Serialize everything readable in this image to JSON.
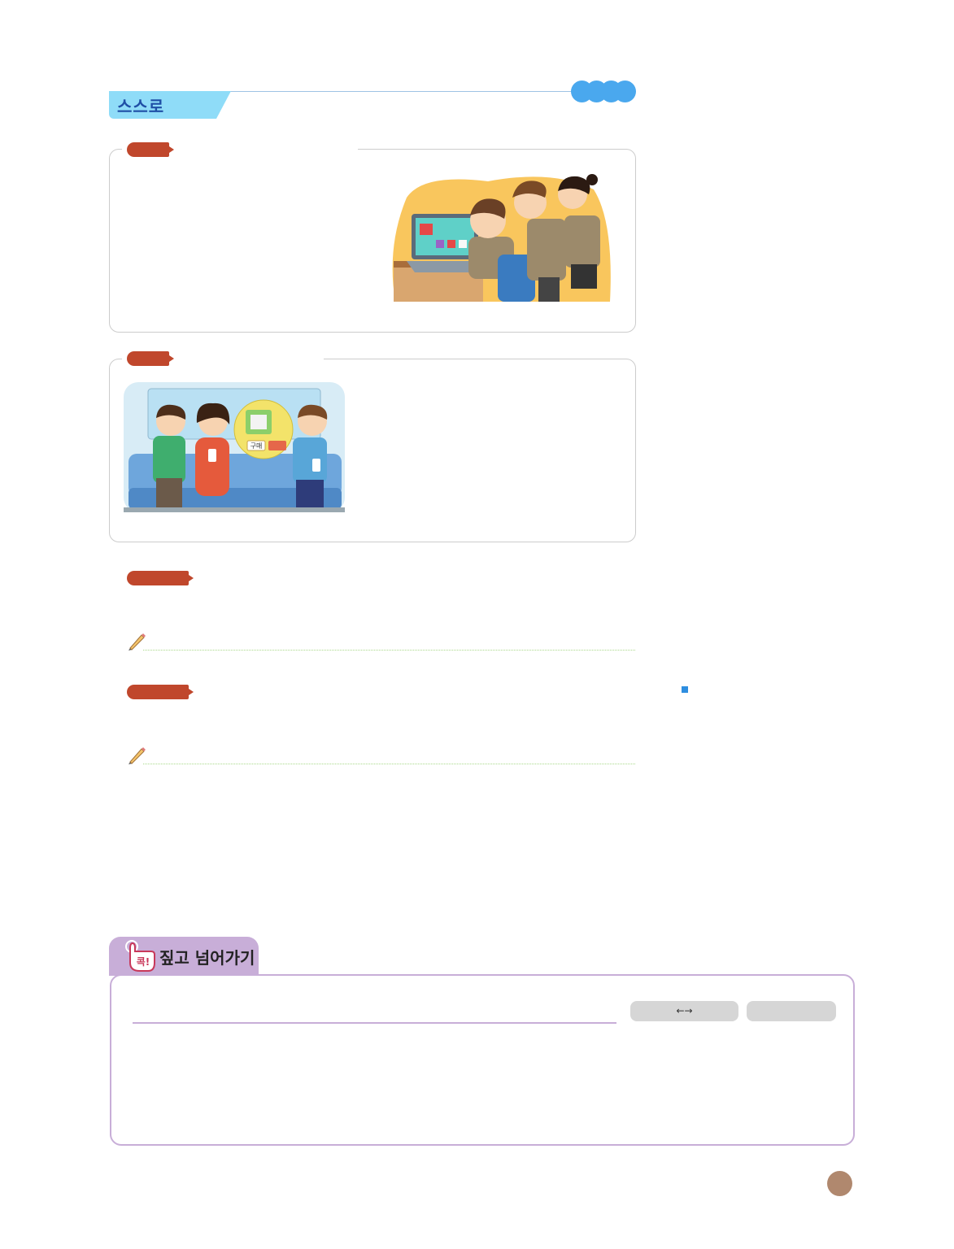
{
  "header": {
    "title": "스스로",
    "accent_color": "#8fdcf8",
    "dots_color": "#4aa8ee"
  },
  "sections": [
    {
      "label": "",
      "image": "illustration-students-shopping-online"
    },
    {
      "label": "",
      "image": "illustration-subway-phone-shopping"
    }
  ],
  "questions": [
    {
      "label": "",
      "answer": ""
    },
    {
      "label": "",
      "answer": ""
    }
  ],
  "review": {
    "title": "짚고 넘어가기",
    "badge": "콕!",
    "tab_color": "#c8aed8",
    "arrow_pill": "←→"
  },
  "subway_popup": {
    "buy_button": "구매"
  }
}
